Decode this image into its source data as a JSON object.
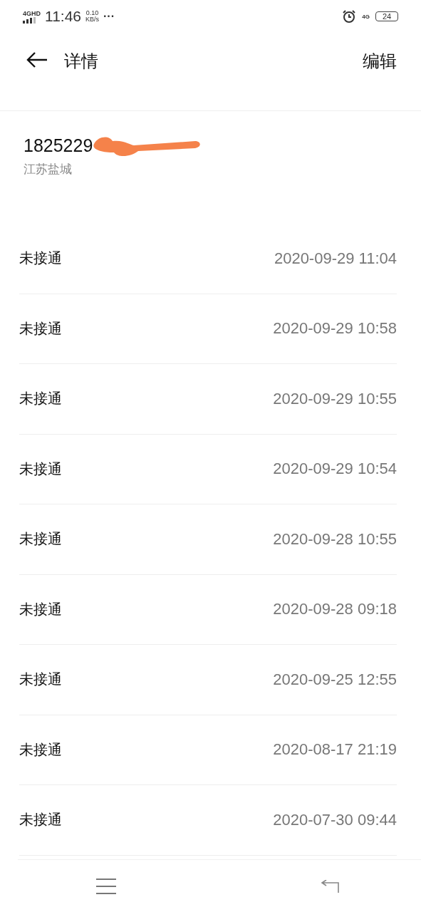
{
  "status_bar": {
    "network": "4G",
    "network_badge": "HD",
    "time": "11:46",
    "speed": "0.10",
    "speed_unit": "KB/s",
    "more": "···",
    "data_network": "4G",
    "battery": "24"
  },
  "app_bar": {
    "title": "详情",
    "action": "编辑"
  },
  "contact": {
    "number": "1825229",
    "location": "江苏盐城"
  },
  "calls": [
    {
      "status": "未接通",
      "time": "2020-09-29 11:04"
    },
    {
      "status": "未接通",
      "time": "2020-09-29 10:58"
    },
    {
      "status": "未接通",
      "time": "2020-09-29 10:55"
    },
    {
      "status": "未接通",
      "time": "2020-09-29 10:54"
    },
    {
      "status": "未接通",
      "time": "2020-09-28 10:55"
    },
    {
      "status": "未接通",
      "time": "2020-09-28 09:18"
    },
    {
      "status": "未接通",
      "time": "2020-09-25 12:55"
    },
    {
      "status": "未接通",
      "time": "2020-08-17 21:19"
    },
    {
      "status": "未接通",
      "time": "2020-07-30 09:44"
    }
  ]
}
